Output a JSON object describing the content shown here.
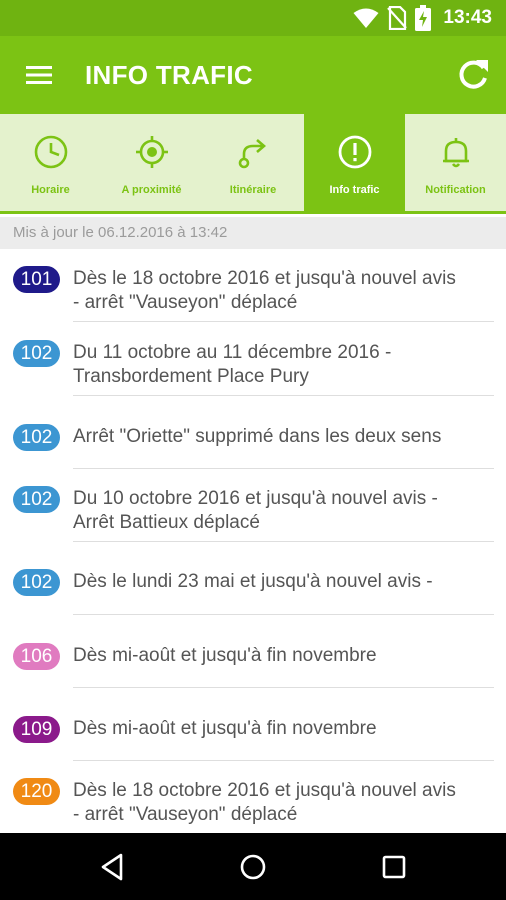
{
  "status_bar": {
    "time": "13:43",
    "icons": [
      "wifi-icon",
      "no-sim-icon",
      "battery-charging-icon"
    ]
  },
  "app_bar": {
    "title": "INFO TRAFIC",
    "menu_icon": "hamburger-menu-icon",
    "refresh_icon": "refresh-icon"
  },
  "tabs": [
    {
      "label": "Horaire",
      "icon": "clock-icon",
      "active": false
    },
    {
      "label": "A proximité",
      "icon": "location-target-icon",
      "active": false
    },
    {
      "label": "Itinéraire",
      "icon": "route-icon",
      "active": false
    },
    {
      "label": "Info trafic",
      "icon": "alert-icon",
      "active": true
    },
    {
      "label": "Notification",
      "icon": "bell-icon",
      "active": false
    }
  ],
  "updated_text": "Mis à jour le 06.12.2016 à 13:42",
  "items": [
    {
      "line": "101",
      "color": "#1f1a8a",
      "lines": [
        "Dès le 18 octobre 2016 et jusqu'à nouvel avis",
        "- arrêt \"Vauseyon\" déplacé"
      ]
    },
    {
      "line": "102",
      "color": "#3c96d2",
      "lines": [
        "Du 11 octobre au 11 décembre 2016 -",
        "Transbordement Place Pury"
      ]
    },
    {
      "line": "102",
      "color": "#3c96d2",
      "lines": [
        "Arrêt \"Oriette\" supprimé dans les deux sens"
      ]
    },
    {
      "line": "102",
      "color": "#3c96d2",
      "lines": [
        "Du 10 octobre 2016 et jusqu'à nouvel avis -",
        "Arrêt Battieux déplacé"
      ]
    },
    {
      "line": "102",
      "color": "#3c96d2",
      "lines": [
        "Dès le lundi 23 mai et jusqu'à nouvel avis -"
      ]
    },
    {
      "line": "106",
      "color": "#e07bc0",
      "lines": [
        "Dès mi-août et jusqu'à fin novembre"
      ]
    },
    {
      "line": "109",
      "color": "#8b1a8b",
      "lines": [
        "Dès mi-août et jusqu'à fin novembre"
      ]
    },
    {
      "line": "120",
      "color": "#f08a14",
      "lines": [
        "Dès le 18 octobre 2016 et jusqu'à nouvel avis",
        "- arrêt \"Vauseyon\" déplacé"
      ]
    }
  ],
  "nav_bar": {
    "back_icon": "back-triangle-icon",
    "home_icon": "home-circle-icon",
    "recents_icon": "recents-square-icon"
  }
}
